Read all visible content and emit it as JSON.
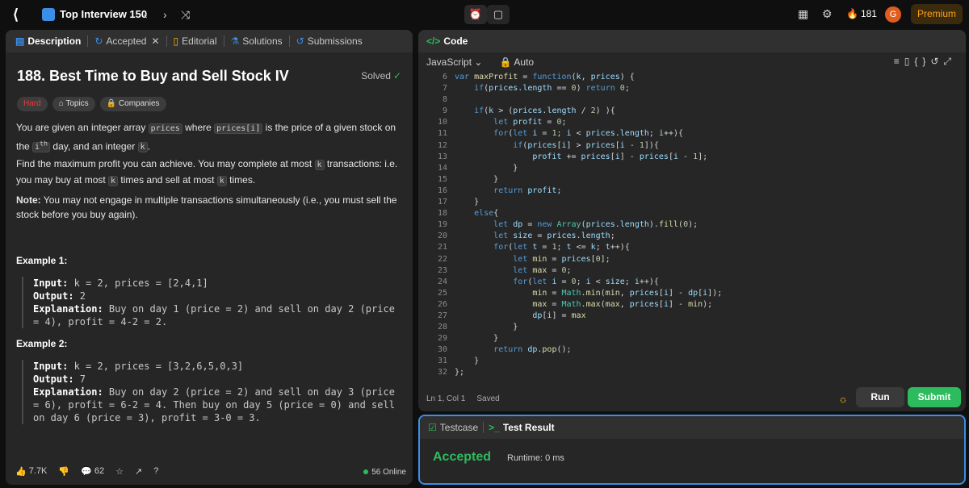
{
  "topbar": {
    "title": "Top Interview 150",
    "streak": "181",
    "avatar": "G",
    "premium": "Premium"
  },
  "left_tabs": [
    {
      "label": "Description",
      "icon": "description-icon"
    },
    {
      "label": "Accepted",
      "icon": "history-icon"
    },
    {
      "label": "Editorial",
      "icon": "book-icon"
    },
    {
      "label": "Solutions",
      "icon": "flask-icon"
    },
    {
      "label": "Submissions",
      "icon": "clock-icon"
    }
  ],
  "problem": {
    "title": "188. Best Time to Buy and Sell Stock IV",
    "status": "Solved",
    "difficulty": "Hard",
    "topics": "Topics",
    "companies": "Companies",
    "p1_a": "You are given an integer array ",
    "p1_code1": "prices",
    "p1_b": " where ",
    "p1_code2": "prices[i]",
    "p1_c": " is the price of a given stock on the ",
    "p1_code3": "i",
    "p1_sup": "th",
    "p1_d": " day, and an integer ",
    "p1_code4": "k",
    "p1_e": ".",
    "p2_a": "Find the maximum profit you can achieve. You may complete at most ",
    "p2_code1": "k",
    "p2_b": " transactions: i.e. you may buy at most ",
    "p2_code2": "k",
    "p2_c": " times and sell at most ",
    "p2_code3": "k",
    "p2_d": " times.",
    "note_label": "Note:",
    "note_text": " You may not engage in multiple transactions simultaneously (i.e., you must sell the stock before you buy again).",
    "ex1_head": "Example 1:",
    "ex1_input_label": "Input:",
    "ex1_input": " k = 2, prices = [2,4,1]",
    "ex1_output_label": "Output:",
    "ex1_output": " 2",
    "ex1_expl_label": "Explanation:",
    "ex1_expl": " Buy on day 1 (price = 2) and sell on day 2 (price = 4), profit = 4-2 = 2.",
    "ex2_head": "Example 2:",
    "ex2_input_label": "Input:",
    "ex2_input": " k = 2, prices = [3,2,6,5,0,3]",
    "ex2_output_label": "Output:",
    "ex2_output": " 7",
    "ex2_expl_label": "Explanation:",
    "ex2_expl": " Buy on day 2 (price = 2) and sell on day 3 (price = 6), profit = 6-2 = 4. Then buy on day 5 (price = 0) and sell on day 6 (price = 3), profit = 3-0 = 3."
  },
  "left_footer": {
    "likes": "7.7K",
    "comments": "62",
    "online": "56 Online"
  },
  "code_panel": {
    "tab": "Code",
    "language": "JavaScript",
    "mode": "Auto",
    "status_pos": "Ln 1, Col 1",
    "status_saved": "Saved",
    "run": "Run",
    "submit": "Submit"
  },
  "code_lines": [
    {
      "n": "6",
      "t": "var maxProfit = function(k, prices) {"
    },
    {
      "n": "7",
      "t": "    if(prices.length == 0) return 0;"
    },
    {
      "n": "8",
      "t": ""
    },
    {
      "n": "9",
      "t": "    if(k > (prices.length / 2) ){"
    },
    {
      "n": "10",
      "t": "        let profit = 0;"
    },
    {
      "n": "11",
      "t": "        for(let i = 1; i < prices.length; i++){"
    },
    {
      "n": "12",
      "t": "            if(prices[i] > prices[i - 1]){"
    },
    {
      "n": "13",
      "t": "                profit += prices[i] - prices[i - 1];"
    },
    {
      "n": "14",
      "t": "            }"
    },
    {
      "n": "15",
      "t": "        }"
    },
    {
      "n": "16",
      "t": "        return profit;"
    },
    {
      "n": "17",
      "t": "    }"
    },
    {
      "n": "18",
      "t": "    else{"
    },
    {
      "n": "19",
      "t": "        let dp = new Array(prices.length).fill(0);"
    },
    {
      "n": "20",
      "t": "        let size = prices.length;"
    },
    {
      "n": "21",
      "t": "        for(let t = 1; t <= k; t++){"
    },
    {
      "n": "22",
      "t": "            let min = prices[0];"
    },
    {
      "n": "23",
      "t": "            let max = 0;"
    },
    {
      "n": "24",
      "t": "            for(let i = 0; i < size; i++){"
    },
    {
      "n": "25",
      "t": "                min = Math.min(min, prices[i] - dp[i]);"
    },
    {
      "n": "26",
      "t": "                max = Math.max(max, prices[i] - min);"
    },
    {
      "n": "27",
      "t": "                dp[i] = max"
    },
    {
      "n": "28",
      "t": "            }"
    },
    {
      "n": "29",
      "t": "        }"
    },
    {
      "n": "30",
      "t": "        return dp.pop();"
    },
    {
      "n": "31",
      "t": "    }"
    },
    {
      "n": "32",
      "t": "};"
    }
  ],
  "result_panel": {
    "tab1": "Testcase",
    "tab2": "Test Result",
    "verdict": "Accepted",
    "runtime": "Runtime: 0 ms"
  }
}
